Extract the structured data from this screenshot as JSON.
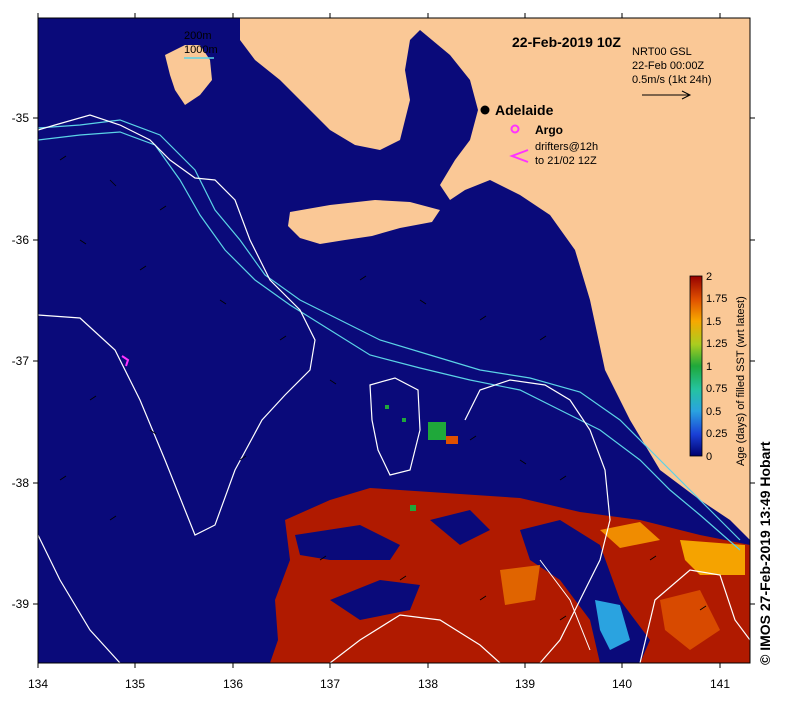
{
  "map": {
    "datetime_title": "22-Feb-2019 10Z",
    "x_ticks": [
      "134",
      "135",
      "136",
      "137",
      "138",
      "139",
      "140",
      "141"
    ],
    "y_ticks": [
      "-35",
      "-36",
      "-37",
      "-38",
      "-39"
    ],
    "legend_isobath": {
      "line1": "200m",
      "line2": "1000m"
    },
    "legend_current": {
      "line1": "NRT00 GSL",
      "line2": "22-Feb 00:00Z",
      "line3": "0.5m/s (1kt 24h)"
    },
    "city": {
      "name": "Adelaide"
    },
    "argo_label": "Argo",
    "drifters_label": {
      "line1": "drifters@12h",
      "line2": "to 21/02 12Z"
    },
    "credit": "© IMOS 27-Feb-2019 13:49 Hobart"
  },
  "colorbar": {
    "label": "Age (days) of filled SST (wrt latest)",
    "ticks": [
      "2",
      "1.75",
      "1.5",
      "1.25",
      "1",
      "0.75",
      "0.5",
      "0.25",
      "0"
    ],
    "range": [
      0,
      2
    ]
  },
  "colors": {
    "ocean": "#0a0a7a",
    "land": "#fac896",
    "old_sst": "#b01a00",
    "contour": "#ffffff",
    "isobath": "#5bd3e6",
    "argo": "#ff33ff"
  }
}
